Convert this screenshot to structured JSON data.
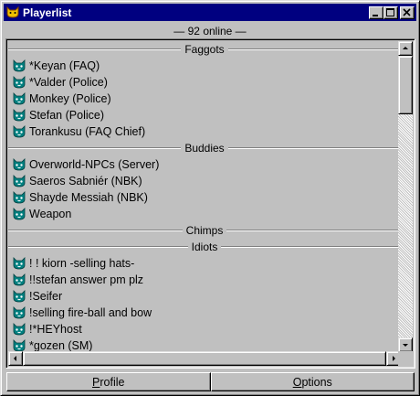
{
  "window": {
    "title": "Playerlist",
    "icon": "cat-face-icon",
    "controls": [
      "minimize",
      "maximize",
      "close"
    ]
  },
  "online_text": "— 92 online —",
  "groups": [
    {
      "name": "Faggots",
      "players": [
        "*Keyan (FAQ)",
        "*Valder (Police)",
        "Monkey (Police)",
        "Stefan (Police)",
        "Torankusu (FAQ Chief)"
      ]
    },
    {
      "name": "Buddies",
      "players": [
        "Overworld-NPCs (Server)",
        "Saeros Sabniér (NBK)",
        "Shayde Messiah (NBK)",
        "Weapon"
      ]
    },
    {
      "name": "Chimps",
      "players": []
    },
    {
      "name": "Idiots",
      "players": [
        "! ! kiorn -selling hats-",
        "!!stefan answer pm plz",
        "!Seifer",
        "!selling fire-ball and bow",
        "!*HEYhost",
        "*gozen (SM)"
      ]
    }
  ],
  "buttons": {
    "profile": {
      "accel": "P",
      "rest": "rofile"
    },
    "options": {
      "accel": "O",
      "rest": "ptions"
    }
  },
  "colors": {
    "titlebar": "#000080",
    "face": "#c0c0c0",
    "player_icon": "#008080"
  }
}
